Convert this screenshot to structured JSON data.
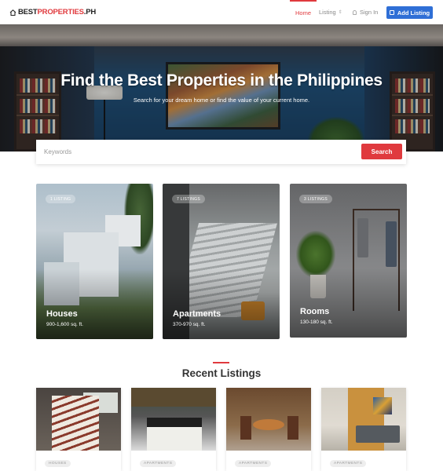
{
  "header": {
    "logo_prefix": "BEST",
    "logo_accent": "PROPERTIES",
    "logo_suffix": ".PH",
    "nav": {
      "home": "Home",
      "listing": "Listing",
      "sign_in": "Sign In",
      "add_listing": "Add Listing"
    }
  },
  "hero": {
    "title": "Find the Best Properties in the Philippines",
    "subtitle": "Search for your dream home or find the value of your current home."
  },
  "search": {
    "placeholder": "Keywords",
    "value": "",
    "button": "Search"
  },
  "categories": [
    {
      "badge": "1 LISTING",
      "name": "Houses",
      "size": "900-1,600 sq. ft."
    },
    {
      "badge": "7 LISTINGS",
      "name": "Apartments",
      "size": "370-970 sq. ft."
    },
    {
      "badge": "3 LISTINGS",
      "name": "Rooms",
      "size": "130-180 sq. ft."
    }
  ],
  "recent": {
    "title": "Recent Listings",
    "items": [
      {
        "tag": "HOUSES"
      },
      {
        "tag": "APARTMENTS"
      },
      {
        "tag": "APARTMENTS"
      },
      {
        "tag": "APARTMENTS"
      }
    ]
  },
  "colors": {
    "accent": "#e03a3e",
    "primary_button": "#2f6fd6"
  }
}
